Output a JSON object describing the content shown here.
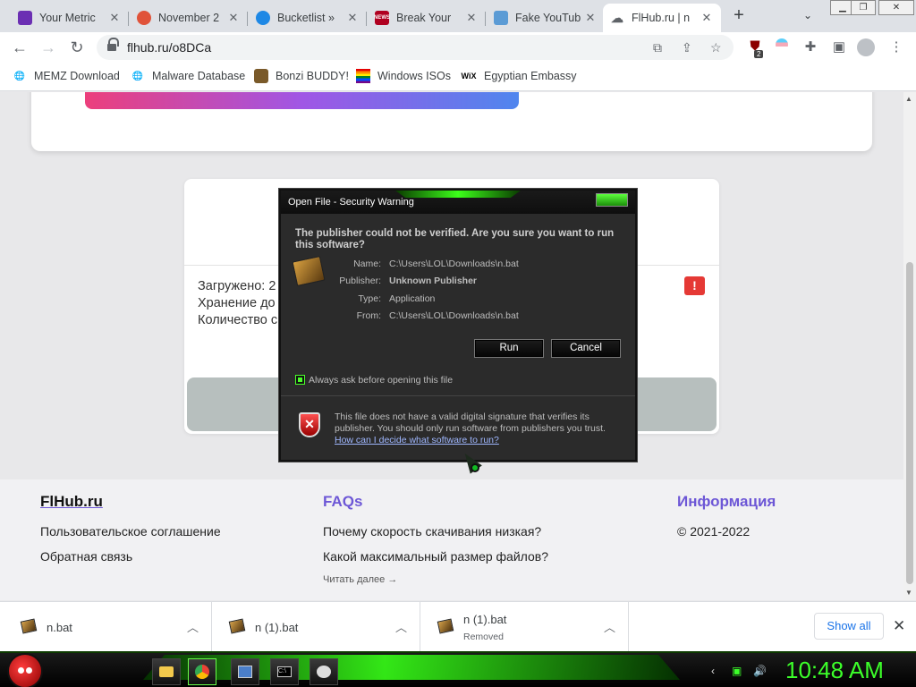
{
  "browser": {
    "tabs": [
      {
        "title": "Your Metric ",
        "icon": "metric-icon",
        "color": "#6b2fb3"
      },
      {
        "title": "November 2",
        "icon": "shield-icon",
        "color": "#e0533a"
      },
      {
        "title": "Bucketlist » ",
        "icon": "globe-icon",
        "color": "#1e88e5"
      },
      {
        "title": "Break Your ",
        "icon": "news-icon",
        "color": "#b00020"
      },
      {
        "title": "Fake YouTub",
        "icon": "page-icon",
        "color": "#5b9bd5"
      },
      {
        "title": "FlHub.ru | n",
        "icon": "cloud-icon",
        "color": "#5f6368"
      }
    ],
    "url": "flhub.ru/o8DCa",
    "extension_badge": "2",
    "bookmarks": [
      {
        "label": "MEMZ Download",
        "icon": "globe-icon"
      },
      {
        "label": "Malware Database",
        "icon": "globe-icon"
      },
      {
        "label": "Bonzi BUDDY!",
        "icon": "bonzi-icon"
      },
      {
        "label": "Windows ISOs",
        "icon": "rainbow-icon"
      },
      {
        "label": "Egyptian Embassy",
        "icon": "wix-icon",
        "badge": "WiX"
      }
    ]
  },
  "page": {
    "info": {
      "uploaded": "Загружено: 2",
      "storage": "Хранение до",
      "count": "Количество с"
    },
    "alert_symbol": "!",
    "footer": {
      "brand": "FlHub.ru",
      "links_col1": [
        "Пользовательское соглашение",
        "Обратная связь"
      ],
      "faq_title": "FAQs",
      "faq_links": [
        "Почему скорость скачивания низкая?",
        "Какой максимальный размер файлов?"
      ],
      "read_more": "Читать далее →",
      "info_title": "Информация",
      "copyright": "© 2021-2022"
    },
    "colors": {
      "accent": "#6d57d6",
      "alert": "#e53935"
    }
  },
  "dialog": {
    "title": "Open File - Security Warning",
    "question": "The publisher could not be verified.  Are you sure you want to run this software?",
    "fields": [
      {
        "key": "Name:",
        "value": "C:\\Users\\LOL\\Downloads\\n.bat",
        "bold": false
      },
      {
        "key": "Publisher:",
        "value": "Unknown Publisher",
        "bold": true
      },
      {
        "key": "Type:",
        "value": "Application",
        "bold": false
      },
      {
        "key": "From:",
        "value": "C:\\Users\\LOL\\Downloads\\n.bat",
        "bold": false
      }
    ],
    "run_label": "Run",
    "cancel_label": "Cancel",
    "checkbox_label": "Always ask before opening this file",
    "checkbox_checked": true,
    "note": "This file does not have a valid digital signature that verifies its publisher.  You should only run software from publishers you trust.",
    "help_link": "How can I decide what software to run?",
    "shield_symbol": "✕"
  },
  "downloads": {
    "items": [
      {
        "name": "n.bat",
        "status": ""
      },
      {
        "name": "n (1).bat",
        "status": ""
      },
      {
        "name": "n (1).bat",
        "status": "Removed"
      }
    ],
    "show_all": "Show all"
  },
  "taskbar": {
    "clock": "10:48 AM",
    "theme_color": "#37ff17"
  }
}
